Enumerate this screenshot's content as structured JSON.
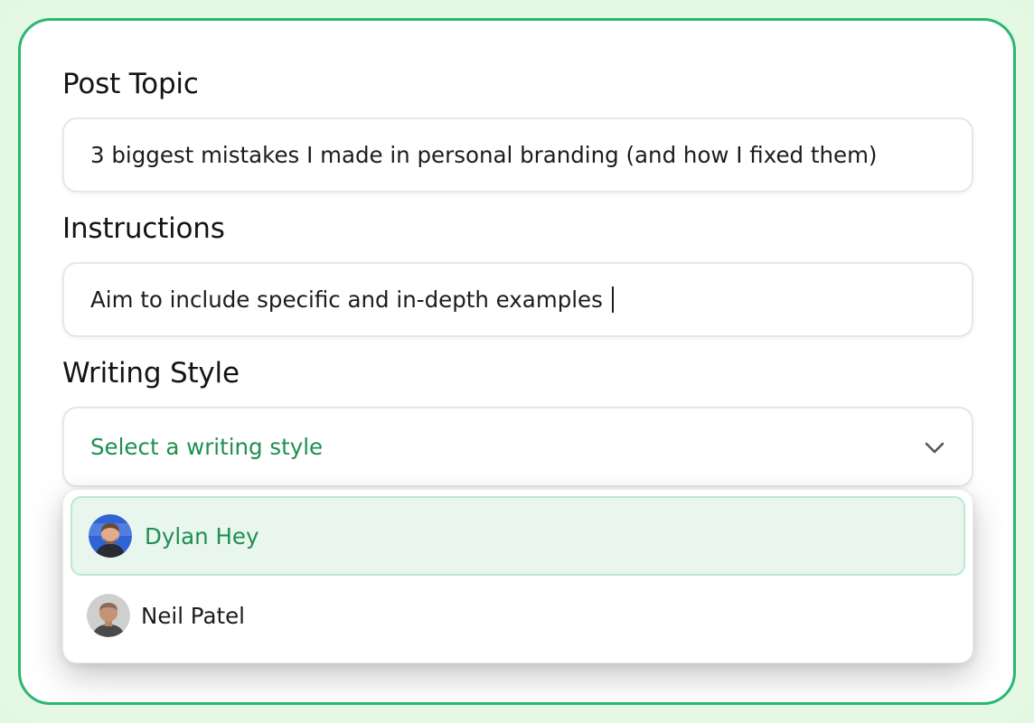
{
  "form": {
    "post_topic": {
      "label": "Post Topic",
      "value": "3 biggest mistakes I made in personal branding (and how I fixed them)"
    },
    "instructions": {
      "label": "Instructions",
      "value": "Aim to include specific and in-depth examples"
    },
    "writing_style": {
      "label": "Writing Style",
      "placeholder": "Select a writing style",
      "options": [
        {
          "label": "Dylan Hey",
          "avatar_icon": "person-avatar-icon",
          "highlighted": true
        },
        {
          "label": "Neil Patel",
          "avatar_icon": "person-avatar-icon",
          "highlighted": false
        }
      ]
    }
  },
  "colors": {
    "accent_green": "#2bb673",
    "text_green": "#1f8f4f",
    "highlight_bg": "#e8f6ee",
    "frame_bg": "#e4f8e4"
  }
}
